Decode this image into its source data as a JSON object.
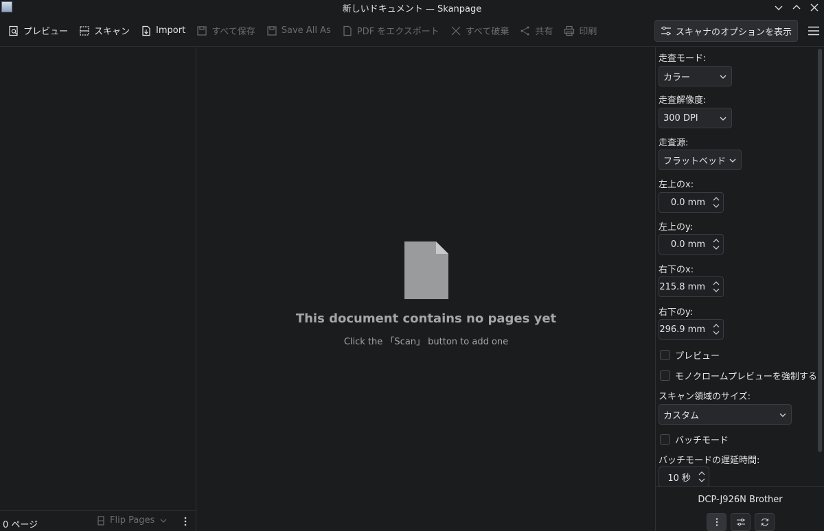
{
  "window": {
    "title": "新しいドキュメント — Skanpage"
  },
  "toolbar": {
    "preview": "プレビュー",
    "scan": "スキャン",
    "import": "Import",
    "save_all": "すべて保存",
    "save_all_as": "Save All As",
    "export_pdf": "PDF をエクスポート",
    "discard_all": "すべて破棄",
    "share": "共有",
    "print": "印刷",
    "scanner_options": "スキャナのオプションを表示"
  },
  "left_footer": {
    "page_count": "0 ページ",
    "flip_pages": "Flip Pages"
  },
  "empty_state": {
    "title": "This document contains no pages yet",
    "subtitle": "Click the 「Scan」 button to add one"
  },
  "options": {
    "scan_mode_label": "走査モード:",
    "scan_mode_value": "カラー",
    "resolution_label": "走査解像度:",
    "resolution_value": "300 DPI",
    "source_label": "走査源:",
    "source_value": "フラットベッド",
    "top_left_x_label": "左上のx:",
    "top_left_x_value": "0.0 mm",
    "top_left_y_label": "左上のy:",
    "top_left_y_value": "0.0 mm",
    "bottom_right_x_label": "右下のx:",
    "bottom_right_x_value": "215.8 mm",
    "bottom_right_y_label": "右下のy:",
    "bottom_right_y_value": "296.9 mm",
    "preview_checkbox": "プレビュー",
    "mono_preview_checkbox": "モノクロームプレビューを強制する",
    "area_size_label": "スキャン領域のサイズ:",
    "area_size_value": "カスタム",
    "batch_mode_checkbox": "バッチモード",
    "batch_delay_label": "バッチモードの遅延時間:",
    "batch_delay_value": "10 秒"
  },
  "device": {
    "name": "DCP-J926N Brother"
  }
}
